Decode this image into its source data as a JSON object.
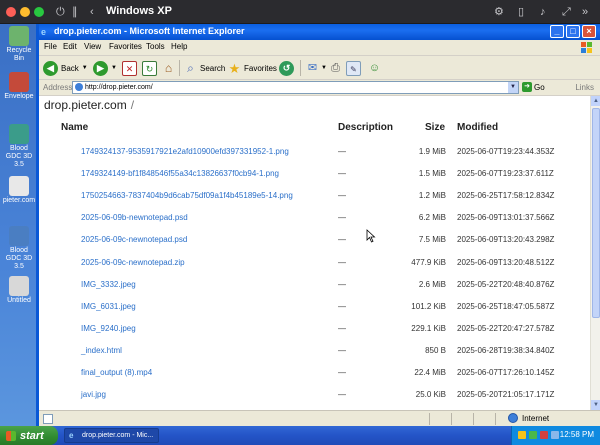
{
  "host": {
    "window_title": "Windows XP"
  },
  "desktop": {
    "icons": [
      {
        "label": "Recycle Bin",
        "icon": "recycle-bin-icon"
      },
      {
        "label": "Envelope",
        "icon": "envelope-icon"
      },
      {
        "label": "Blood GDC 3D 3.5",
        "icon": "app-icon"
      },
      {
        "label": "pieter.com",
        "icon": "document-icon"
      },
      {
        "label": "Blood GDC 3D 3.5",
        "icon": "app-icon"
      },
      {
        "label": "Untitled",
        "icon": "notepad-icon"
      }
    ]
  },
  "ie": {
    "title": "drop.pieter.com - Microsoft Internet Explorer",
    "menu": [
      "File",
      "Edit",
      "View",
      "Favorites",
      "Tools",
      "Help"
    ],
    "toolbar": {
      "back": "Back",
      "search": "Search",
      "favorites": "Favorites"
    },
    "address": {
      "label": "Address",
      "url": "http://drop.pieter.com/",
      "go": "Go",
      "links": "Links"
    },
    "status": {
      "zone": "Internet"
    }
  },
  "listing": {
    "site": "drop.pieter.com",
    "path_sep": "/",
    "columns": {
      "name": "Name",
      "description": "Description",
      "size": "Size",
      "modified": "Modified"
    },
    "rows": [
      {
        "name": "1749324137-9535917921e2afd10900efd397331952-1.png",
        "desc": "—",
        "size": "1.9 MiB",
        "modified": "2025-06-07T19:23:44.353Z"
      },
      {
        "name": "1749324149-bf1f848546f55a34c13826637f0cb94-1.png",
        "desc": "—",
        "size": "1.5 MiB",
        "modified": "2025-06-07T19:23:37.611Z"
      },
      {
        "name": "1750254663-7837404b9d6cab75df09a1f4b45189e5-14.png",
        "desc": "—",
        "size": "1.2 MiB",
        "modified": "2025-06-25T17:58:12.834Z"
      },
      {
        "name": "2025-06-09b-newnotepad.psd",
        "desc": "—",
        "size": "6.2 MiB",
        "modified": "2025-06-09T13:01:37.566Z"
      },
      {
        "name": "2025-06-09c-newnotepad.psd",
        "desc": "—",
        "size": "7.5 MiB",
        "modified": "2025-06-09T13:20:43.298Z"
      },
      {
        "name": "2025-06-09c-newnotepad.zip",
        "desc": "—",
        "size": "477.9 KiB",
        "modified": "2025-06-09T13:20:48.512Z"
      },
      {
        "name": "IMG_3332.jpeg",
        "desc": "—",
        "size": "2.6 MiB",
        "modified": "2025-05-22T20:48:40.876Z"
      },
      {
        "name": "IMG_6031.jpeg",
        "desc": "—",
        "size": "101.2 KiB",
        "modified": "2025-06-25T18:47:05.587Z"
      },
      {
        "name": "IMG_9240.jpeg",
        "desc": "—",
        "size": "229.1 KiB",
        "modified": "2025-05-22T20:47:27.578Z"
      },
      {
        "name": "_index.html",
        "desc": "—",
        "size": "850 B",
        "modified": "2025-06-28T19:38:34.840Z"
      },
      {
        "name": "final_output (8).mp4",
        "desc": "—",
        "size": "22.4 MiB",
        "modified": "2025-06-07T17:26:10.145Z"
      },
      {
        "name": "javi.jpg",
        "desc": "—",
        "size": "25.0 KiB",
        "modified": "2025-05-20T21:05:17.171Z"
      }
    ]
  },
  "taskbar": {
    "start": "start",
    "task": "drop.pieter.com - Mic...",
    "clock": "12:58 PM"
  },
  "colors": {
    "xp_blue": "#0a5fe0",
    "link": "#2a6fc9",
    "start_green": "#2f8a2f"
  }
}
